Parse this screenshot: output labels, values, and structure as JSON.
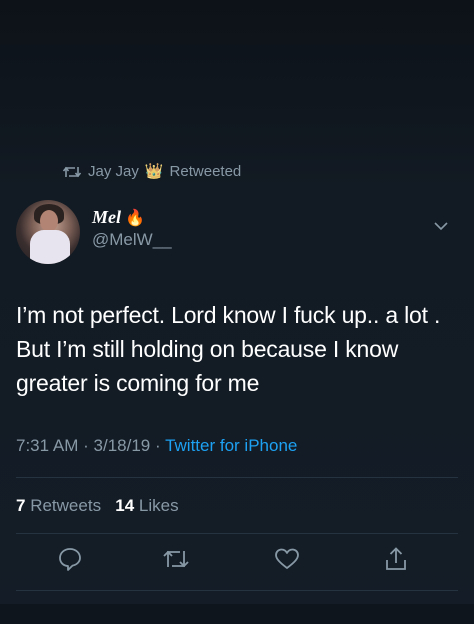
{
  "retweet_context": {
    "name": "Jay Jay",
    "crown_emoji": "👑",
    "label": "Retweeted"
  },
  "author": {
    "display_name": "Mel",
    "emoji": "🔥",
    "handle": "@MelW__"
  },
  "tweet": {
    "text": "I’m not perfect. Lord know I fuck up.. a lot . But I’m still holding on because I know greater is coming for me",
    "time": "7:31 AM",
    "date": "3/18/19",
    "separator": "·",
    "source": "Twitter for iPhone"
  },
  "stats": {
    "retweets_count": "7",
    "retweets_label": "Retweets",
    "likes_count": "14",
    "likes_label": "Likes"
  },
  "icons": {
    "retweet_context": "retweet-icon",
    "menu": "chevron-down-icon",
    "reply": "reply-icon",
    "retweet": "retweet-icon",
    "like": "heart-icon",
    "share": "share-icon"
  },
  "colors": {
    "background": "#141d26",
    "secondary_text": "#8899a6",
    "link": "#1da1f2",
    "divider": "#253341"
  }
}
